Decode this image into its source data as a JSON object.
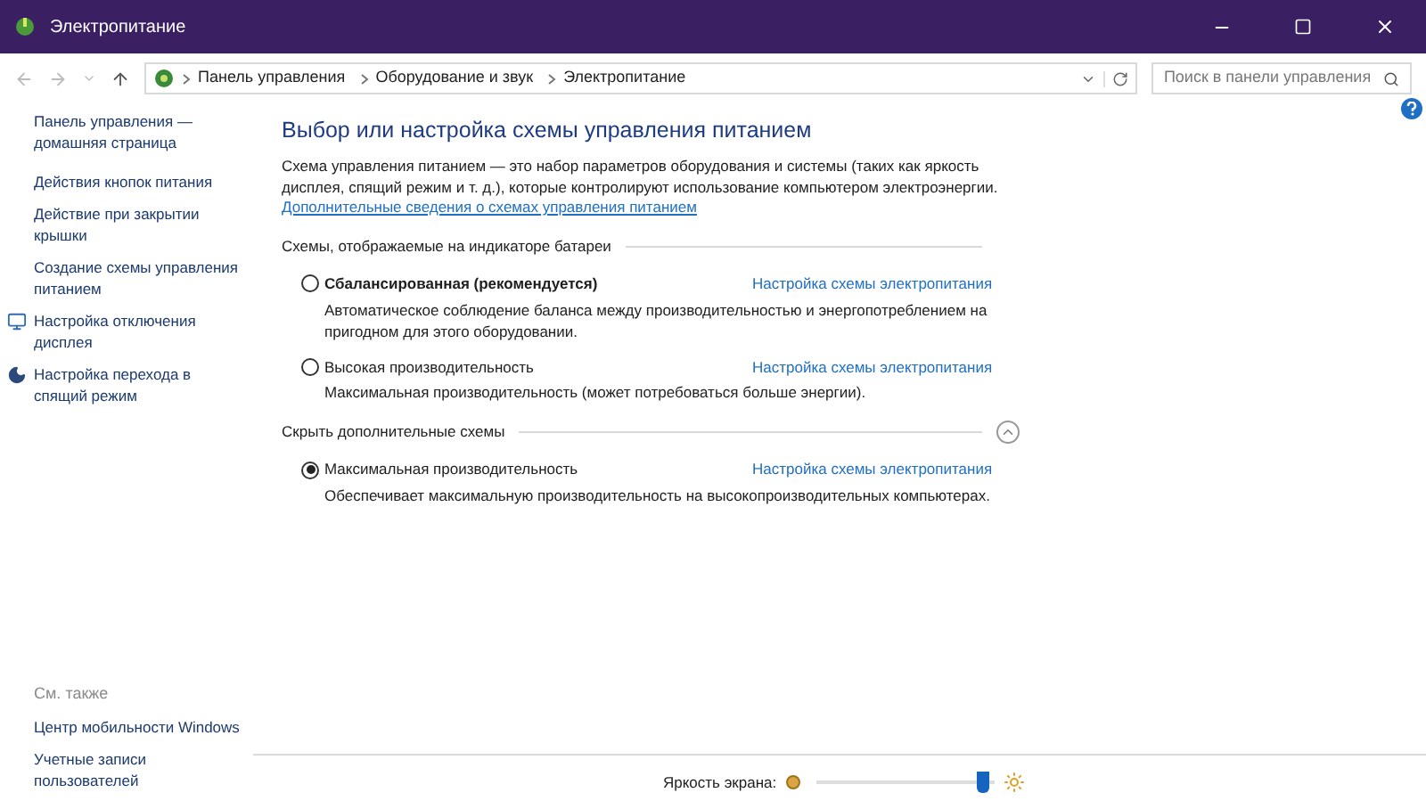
{
  "window": {
    "title": "Электропитание"
  },
  "address": {
    "breadcrumbs": [
      "Панель управления",
      "Оборудование и звук",
      "Электропитание"
    ]
  },
  "search": {
    "placeholder": "Поиск в панели управления"
  },
  "sidebar": {
    "items": [
      {
        "label": "Панель управления — домашняя страница",
        "kind": "plain"
      },
      {
        "label": "Действия кнопок питания",
        "kind": "plain"
      },
      {
        "label": "Действие при закрытии крышки",
        "kind": "plain"
      },
      {
        "label": "Создание схемы управления питанием",
        "kind": "plain"
      },
      {
        "label": "Настройка отключения дисплея",
        "kind": "display"
      },
      {
        "label": "Настройка перехода в спящий режим",
        "kind": "sleep"
      }
    ],
    "see_also_heading": "См. также",
    "see_also": [
      "Центр мобильности Windows",
      "Учетные записи пользователей"
    ]
  },
  "main": {
    "title": "Выбор или настройка схемы управления питанием",
    "description": "Схема управления питанием — это набор параметров оборудования и системы (таких как яркость дисплея, спящий режим и т. д.), которые контролируют использование компьютером электроэнергии.",
    "more_link": "Дополнительные сведения о схемах управления питанием",
    "groups": [
      {
        "heading": "Схемы, отображаемые на индикаторе батареи",
        "expanded": false,
        "plans": [
          {
            "name": "Сбалансированная (рекомендуется)",
            "bold": true,
            "selected": false,
            "link": "Настройка схемы электропитания",
            "description": "Автоматическое соблюдение баланса между производительностью и энергопотреблением на пригодном для этого оборудовании."
          },
          {
            "name": "Высокая производительность",
            "bold": false,
            "selected": false,
            "link": "Настройка схемы электропитания",
            "description": "Максимальная производительность (может потребоваться больше энергии)."
          }
        ]
      },
      {
        "heading": "Скрыть дополнительные схемы",
        "expanded": true,
        "plans": [
          {
            "name": "Максимальная производительность",
            "bold": false,
            "selected": true,
            "link": "Настройка схемы электропитания",
            "description": "Обеспечивает максимальную производительность на высокопроизводительных компьютерах."
          }
        ]
      }
    ]
  },
  "brightness": {
    "label": "Яркость экрана:",
    "level": 0.93
  }
}
